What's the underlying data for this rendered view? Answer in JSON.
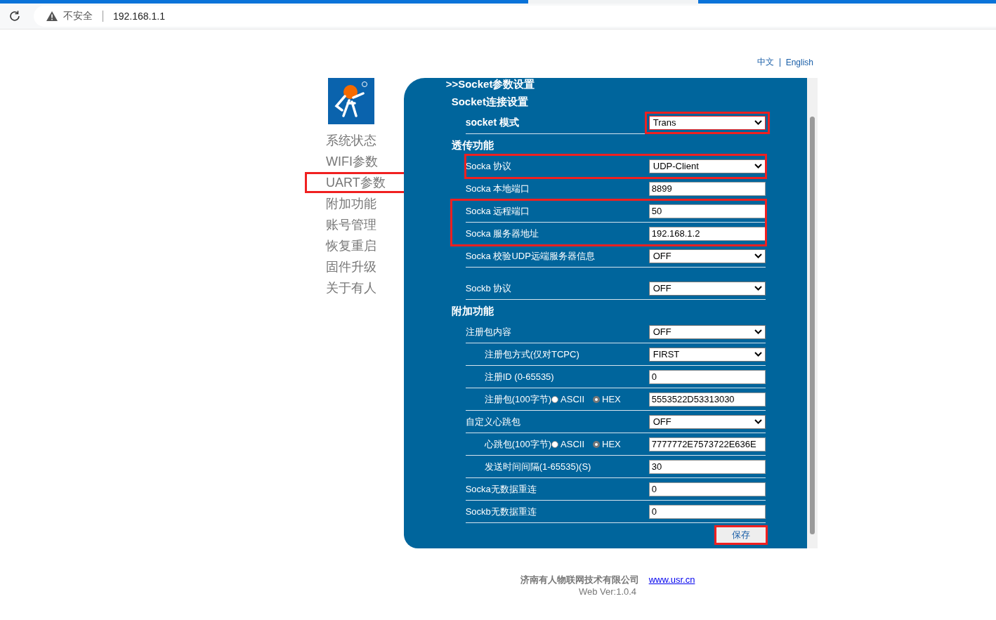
{
  "browser": {
    "security": "不安全",
    "url": "192.168.1.1"
  },
  "languages": [
    "中文",
    "English"
  ],
  "nav": [
    {
      "label": "系统状态",
      "highlighted": false
    },
    {
      "label": "WIFI参数",
      "highlighted": false
    },
    {
      "label": "UART参数",
      "highlighted": true
    },
    {
      "label": "附加功能",
      "highlighted": false
    },
    {
      "label": "账号管理",
      "highlighted": false
    },
    {
      "label": "恢复重启",
      "highlighted": false
    },
    {
      "label": "固件升级",
      "highlighted": false
    },
    {
      "label": "关于有人",
      "highlighted": false
    }
  ],
  "panel": {
    "title": ">>Socket参数设置",
    "sections": [
      {
        "title": "Socket连接设置",
        "rows": [
          {
            "kind": "select",
            "label": "socket 模式",
            "value": "Trans",
            "control_highlighted": true,
            "bold": true
          }
        ]
      },
      {
        "title": "透传功能",
        "rows": [
          {
            "kind": "select",
            "label": "Socka 协议",
            "value": "UDP-Client",
            "highlighted": true
          },
          {
            "kind": "input",
            "label": "Socka 本地端口",
            "value": "8899"
          },
          {
            "kind": "group",
            "highlighted": true,
            "rows": [
              {
                "kind": "input",
                "label": "Socka 远程端口",
                "value": "50"
              },
              {
                "kind": "input",
                "label": "Socka 服务器地址",
                "value": "192.168.1.2"
              }
            ]
          },
          {
            "kind": "select",
            "label": "Socka 校验UDP远端服务器信息",
            "value": "OFF"
          },
          {
            "kind": "select",
            "label": "Sockb 协议",
            "value": "OFF",
            "spaced": true
          }
        ]
      },
      {
        "title": "附加功能",
        "rows": [
          {
            "kind": "select",
            "label": "注册包内容",
            "value": "OFF",
            "children": [
              {
                "kind": "select",
                "label": "注册包方式(仅对TCPC)",
                "value": "FIRST"
              },
              {
                "kind": "input",
                "label": "注册ID (0-65535)",
                "value": "0"
              },
              {
                "kind": "radio-input",
                "label": "注册包(100字节)",
                "options": [
                  {
                    "label": "ASCII",
                    "selected": false
                  },
                  {
                    "label": "HEX",
                    "selected": true
                  }
                ],
                "value": "5553522D53313030"
              }
            ]
          },
          {
            "kind": "select",
            "label": "自定义心跳包",
            "value": "OFF",
            "children": [
              {
                "kind": "radio-input",
                "label": "心跳包(100字节)",
                "options": [
                  {
                    "label": "ASCII",
                    "selected": false
                  },
                  {
                    "label": "HEX",
                    "selected": true
                  }
                ],
                "value": "7777772E7573722E636E"
              },
              {
                "kind": "input",
                "label": "发送时间间隔(1-65535)(S)",
                "value": "30"
              }
            ]
          },
          {
            "kind": "input",
            "label": "Socka无数据重连",
            "value": "0"
          },
          {
            "kind": "input",
            "label": "Sockb无数据重连",
            "value": "0"
          }
        ]
      }
    ],
    "save": {
      "label": "保存",
      "highlighted": true
    }
  },
  "footer": {
    "company": "济南有人物联网技术有限公司",
    "link": "www.usr.cn",
    "version": "Web Ver:1.0.4"
  }
}
